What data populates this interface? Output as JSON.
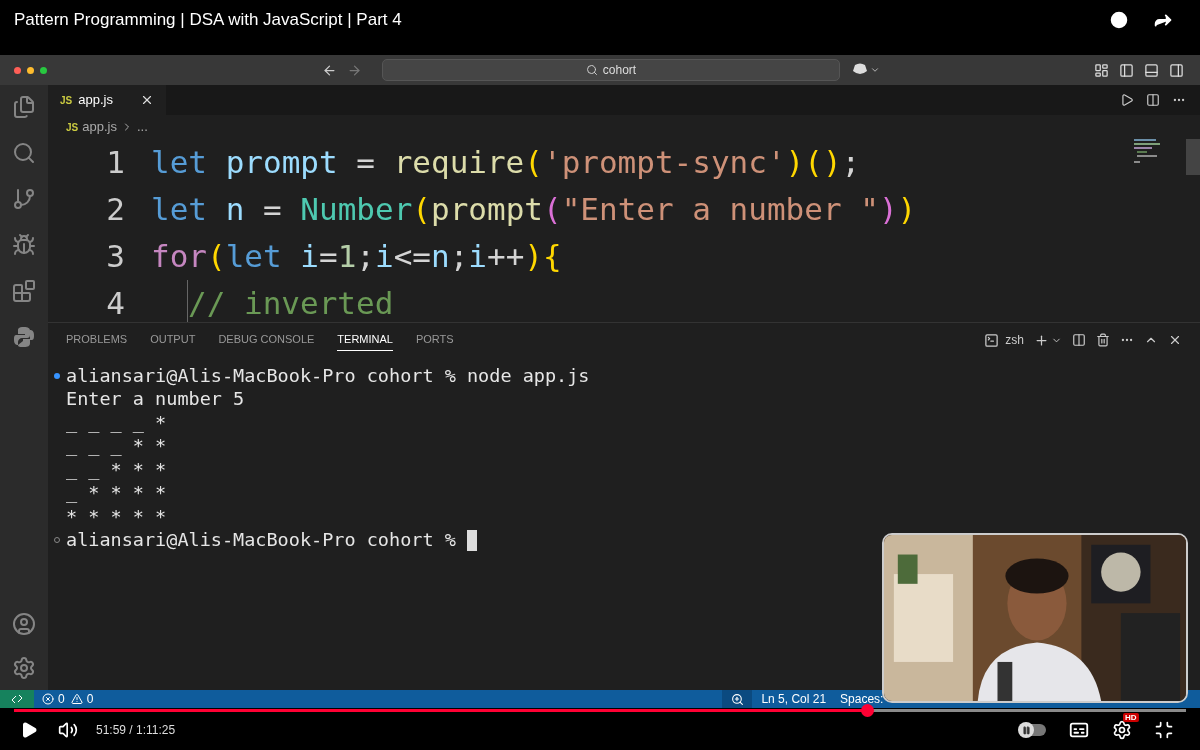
{
  "video": {
    "title": "Pattern Programming | DSA with JavaScript | Part 4",
    "time": "51:59 / 1:11:25",
    "level": 0.728,
    "quality": "HD"
  },
  "window": {
    "search": "cohort"
  },
  "tab": {
    "badge": "JS",
    "label": "app.js"
  },
  "breadcrumb": {
    "badge": "JS",
    "file": "app.js",
    "rest": "..."
  },
  "code": [
    {
      "number": "1",
      "tokens": [
        {
          "kind": "keyword",
          "text": "let "
        },
        {
          "kind": "variable",
          "text": "prompt"
        },
        {
          "kind": "plain",
          "text": " = "
        },
        {
          "kind": "function",
          "text": "require"
        },
        {
          "kind": "bracket1",
          "text": "("
        },
        {
          "kind": "string",
          "text": "'prompt-sync'"
        },
        {
          "kind": "bracket1",
          "text": ")("
        },
        {
          "kind": "bracket1",
          "text": ")"
        },
        {
          "kind": "plain",
          "text": ";"
        }
      ]
    },
    {
      "number": "2",
      "tokens": [
        {
          "kind": "keyword",
          "text": "let "
        },
        {
          "kind": "variable",
          "text": "n"
        },
        {
          "kind": "plain",
          "text": " = "
        },
        {
          "kind": "type",
          "text": "Number"
        },
        {
          "kind": "bracket1",
          "text": "("
        },
        {
          "kind": "function",
          "text": "prompt"
        },
        {
          "kind": "bracket2",
          "text": "("
        },
        {
          "kind": "string",
          "text": "\"Enter a number \""
        },
        {
          "kind": "bracket2",
          "text": ")"
        },
        {
          "kind": "bracket1",
          "text": ")"
        }
      ]
    },
    {
      "number": "3",
      "tokens": [
        {
          "kind": "control",
          "text": "for"
        },
        {
          "kind": "bracket1",
          "text": "("
        },
        {
          "kind": "keyword",
          "text": "let "
        },
        {
          "kind": "variable",
          "text": "i"
        },
        {
          "kind": "plain",
          "text": "="
        },
        {
          "kind": "number",
          "text": "1"
        },
        {
          "kind": "plain",
          "text": ";"
        },
        {
          "kind": "variable",
          "text": "i"
        },
        {
          "kind": "plain",
          "text": "<="
        },
        {
          "kind": "variable",
          "text": "n"
        },
        {
          "kind": "plain",
          "text": ";"
        },
        {
          "kind": "variable",
          "text": "i"
        },
        {
          "kind": "plain",
          "text": "++"
        },
        {
          "kind": "bracket1",
          "text": "){"
        }
      ]
    },
    {
      "number": "4",
      "indented": true,
      "tokens": [
        {
          "kind": "comment",
          "text": "// inverted"
        }
      ]
    }
  ],
  "panel_tabs": [
    {
      "label": "PROBLEMS",
      "selected": false
    },
    {
      "label": "OUTPUT",
      "selected": false
    },
    {
      "label": "DEBUG CONSOLE",
      "selected": false
    },
    {
      "label": "TERMINAL",
      "selected": true
    },
    {
      "label": "PORTS",
      "selected": false
    }
  ],
  "terminal": {
    "shell": "zsh",
    "lines": [
      {
        "kind": "command",
        "text": "aliansari@Alis-MacBook-Pro cohort % node app.js"
      },
      {
        "kind": "output",
        "text": "Enter a number 5"
      },
      {
        "kind": "output",
        "text": "_ _ _ _ *"
      },
      {
        "kind": "output",
        "text": "_ _ _ * *"
      },
      {
        "kind": "output",
        "text": "_ _ * * *"
      },
      {
        "kind": "output",
        "text": "_ * * * *"
      },
      {
        "kind": "output",
        "text": "* * * * *"
      },
      {
        "kind": "prompt",
        "text": "aliansari@Alis-MacBook-Pro cohort %"
      }
    ]
  },
  "autoplay": {
    "on": false
  },
  "status_bar": {
    "errors": "0",
    "warnings": "0",
    "position": "Ln 5, Col 21",
    "spaces": "Spaces:"
  }
}
